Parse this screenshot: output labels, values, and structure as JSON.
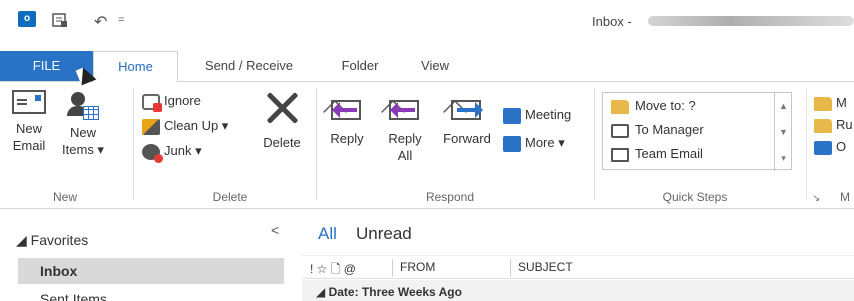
{
  "titlebar": {
    "title_prefix": "Inbox -",
    "app_logo_text": "o",
    "qa_more": "="
  },
  "tabs": {
    "file": "FILE",
    "home": "Home",
    "send_receive": "Send / Receive",
    "folder": "Folder",
    "view": "View"
  },
  "ribbon": {
    "new": {
      "new_email_1": "New",
      "new_email_2": "Email",
      "new_items_1": "New",
      "new_items_2": "Items ▾",
      "group": "New"
    },
    "delete": {
      "ignore": "Ignore",
      "clean_up": "Clean Up ▾",
      "junk": "Junk ▾",
      "delete": "Delete",
      "group": "Delete"
    },
    "respond": {
      "reply": "Reply",
      "reply_all_1": "Reply",
      "reply_all_2": "All",
      "forward": "Forward",
      "meeting": "Meeting",
      "more": "More ▾",
      "group": "Respond"
    },
    "quick_steps": {
      "move_to": "Move to: ?",
      "to_manager": "To Manager",
      "team_email": "Team Email",
      "group": "Quick Steps"
    },
    "move": {
      "item1": "M",
      "item2": "Ru",
      "item3": "O",
      "group": "M"
    }
  },
  "folder_pane": {
    "favorites": "◢ Favorites",
    "collapse": "<",
    "items": [
      "Inbox",
      "Sent Items"
    ]
  },
  "message_list": {
    "filter_all": "All",
    "filter_unread": "Unread",
    "columns": {
      "icons": "! ☆ 🗋 @",
      "from": "FROM",
      "subject": "SUBJECT"
    },
    "group_header": "◢  Date: Three Weeks Ago"
  },
  "colors": {
    "accent": "#2a72c6",
    "file_tab": "#2a72c6",
    "selected_row": "#d9d9d9"
  }
}
